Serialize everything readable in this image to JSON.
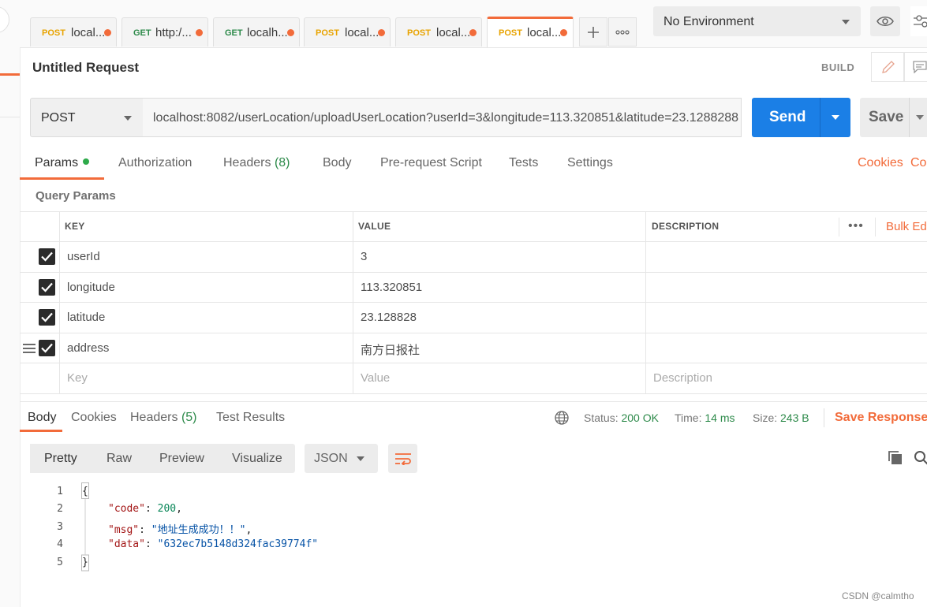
{
  "tabs": [
    {
      "method": "POST",
      "name": "local..."
    },
    {
      "method": "GET",
      "name": "http:/..."
    },
    {
      "method": "GET",
      "name": "localh..."
    },
    {
      "method": "POST",
      "name": "local..."
    },
    {
      "method": "POST",
      "name": "local..."
    },
    {
      "method": "POST",
      "name": "local..."
    }
  ],
  "environment": {
    "selected": "No Environment"
  },
  "request": {
    "title": "Untitled Request",
    "build_label": "BUILD",
    "method": "POST",
    "url": "localhost:8082/userLocation/uploadUserLocation?userId=3&longitude=113.320851&latitude=23.1288288",
    "send_label": "Send",
    "save_label": "Save"
  },
  "request_tabs": {
    "params": "Params",
    "authorization": "Authorization",
    "headers": "Headers",
    "headers_count": "(8)",
    "body": "Body",
    "prerequest": "Pre-request Script",
    "tests": "Tests",
    "settings": "Settings",
    "cookies": "Cookies",
    "code": "Code"
  },
  "query_params": {
    "title": "Query Params",
    "headers": {
      "key": "KEY",
      "value": "VALUE",
      "description": "DESCRIPTION"
    },
    "bulk_edit": "Bulk Edit",
    "rows": [
      {
        "key": "userId",
        "value": "3",
        "description": ""
      },
      {
        "key": "longitude",
        "value": "113.320851",
        "description": ""
      },
      {
        "key": "latitude",
        "value": "23.128828",
        "description": ""
      },
      {
        "key": "address",
        "value": "南方日报社",
        "description": ""
      }
    ],
    "placeholders": {
      "key": "Key",
      "value": "Value",
      "description": "Description"
    }
  },
  "response": {
    "tabs": {
      "body": "Body",
      "cookies": "Cookies",
      "headers": "Headers",
      "headers_count": "(5)",
      "test_results": "Test Results"
    },
    "status_label": "Status:",
    "status_value": "200 OK",
    "time_label": "Time:",
    "time_value": "14 ms",
    "size_label": "Size:",
    "size_value": "243 B",
    "save_response": "Save Response",
    "view_modes": [
      "Pretty",
      "Raw",
      "Preview",
      "Visualize"
    ],
    "format": "JSON",
    "line_numbers": [
      "1",
      "2",
      "3",
      "4",
      "5"
    ],
    "json": {
      "open": "{",
      "close": "}",
      "code_key": "\"code\"",
      "code_val": "200",
      "msg_key": "\"msg\"",
      "msg_val": "\"地址生成成功！！\"",
      "data_key": "\"data\"",
      "data_val": "\"632ec7b5148d324fac39774f\""
    }
  },
  "watermark": "CSDN @calmtho",
  "colors": {
    "accent": "#f26b3a",
    "send": "#1b7fe6",
    "success": "#2d8a4a"
  }
}
